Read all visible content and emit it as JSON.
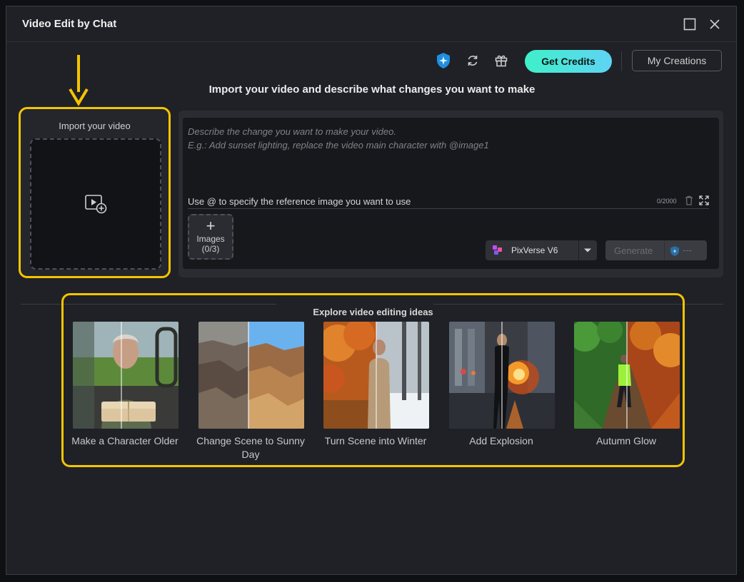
{
  "window": {
    "title": "Video Edit by Chat"
  },
  "toolbar": {
    "credits_label": "Get Credits",
    "creations_label": "My Creations"
  },
  "subtitle": "Import your video and describe what changes you want to make",
  "import": {
    "label": "Import your video"
  },
  "prompt": {
    "placeholder_line1": "Describe the change you want to make your video.",
    "placeholder_line2": "E.g.: Add sunset lighting, replace the video main character with @image1",
    "at_hint": "Use @ to specify the reference image you want to use",
    "char_count": "0/2000",
    "images_label": "Images",
    "images_count": "(0/3)",
    "model": "PixVerse V6",
    "generate_label": "Generate",
    "generate_cost": "---"
  },
  "explore": {
    "title": "Explore video editing ideas",
    "ideas": [
      {
        "label": "Make a Character Older"
      },
      {
        "label": "Change Scene to Sunny Day"
      },
      {
        "label": "Turn Scene into Winter"
      },
      {
        "label": "Add Explosion"
      },
      {
        "label": "Autumn Glow"
      }
    ]
  },
  "colors": {
    "highlight": "#f5c400",
    "accent_start": "#3ff0c9",
    "accent_end": "#5fd3f5",
    "window_bg": "#1f2127"
  }
}
